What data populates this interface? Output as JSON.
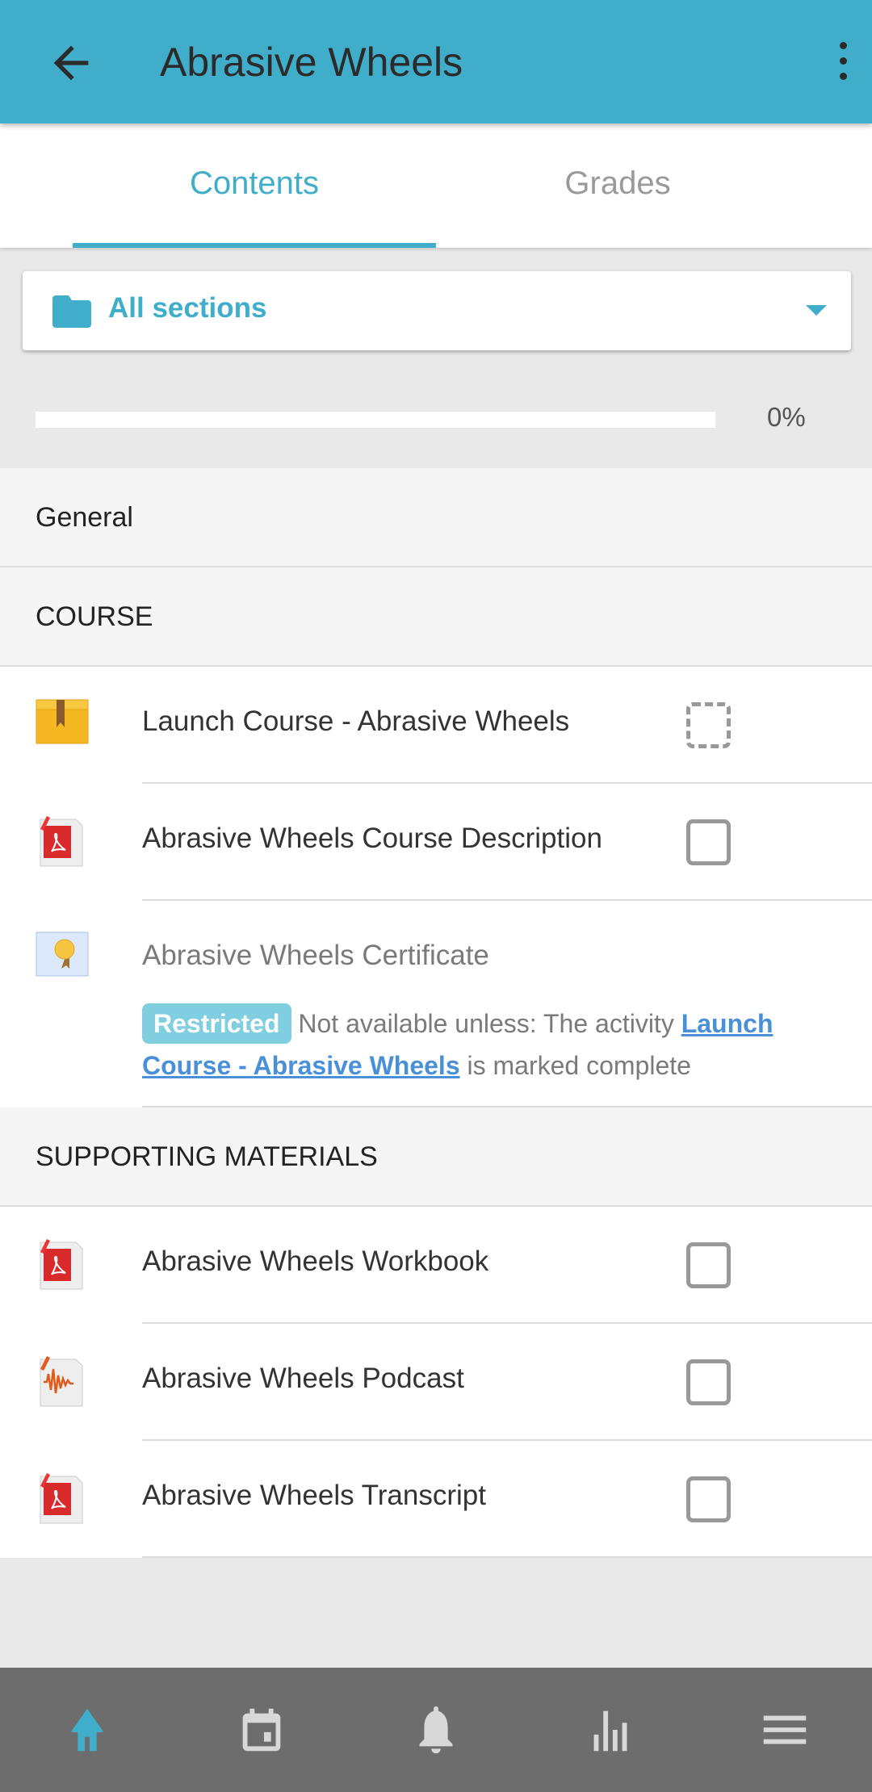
{
  "header": {
    "title": "Abrasive Wheels",
    "back_icon": "arrow-left-icon",
    "menu_icon": "more-vertical-icon",
    "color": "#40aecb"
  },
  "tabs": [
    {
      "label": "Contents",
      "active": true
    },
    {
      "label": "Grades",
      "active": false
    }
  ],
  "section_selector": {
    "icon": "folder-icon",
    "label": "All sections"
  },
  "progress": {
    "value": 0,
    "label": "0%"
  },
  "sections": {
    "general": "General",
    "course": "COURSE",
    "supporting": "SUPPORTING MATERIALS"
  },
  "course_items": [
    {
      "icon": "scorm-package-icon",
      "name": "Launch Course - Abrasive Wheels",
      "completion": "manual-dashed"
    },
    {
      "icon": "pdf-icon",
      "name": "Abrasive Wheels Course Description",
      "completion": "unchecked"
    },
    {
      "icon": "certificate-icon",
      "name": "Abrasive Wheels Certificate",
      "restricted": true
    }
  ],
  "restriction": {
    "badge": "Restricted",
    "text_before": "Not available unless: The activity ",
    "link": "Launch Course - Abrasive Wheels",
    "text_after": " is marked complete"
  },
  "supporting_items": [
    {
      "icon": "pdf-icon",
      "name": "Abrasive Wheels Workbook"
    },
    {
      "icon": "audio-icon",
      "name": "Abrasive Wheels Podcast"
    },
    {
      "icon": "pdf-icon",
      "name": "Abrasive Wheels Transcript"
    }
  ],
  "bottom_nav": [
    {
      "icon": "home-icon",
      "active": true
    },
    {
      "icon": "calendar-icon"
    },
    {
      "icon": "bell-icon"
    },
    {
      "icon": "bar-chart-icon"
    },
    {
      "icon": "menu-icon"
    }
  ]
}
